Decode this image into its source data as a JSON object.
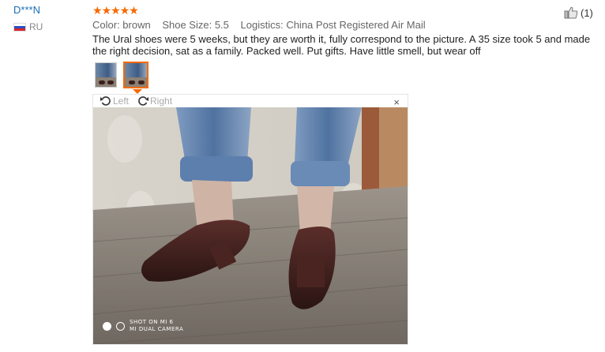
{
  "reviewer": {
    "name": "D***N",
    "country_code": "RU",
    "flag_icon": "russia-flag-icon"
  },
  "rating": {
    "stars": 5,
    "max": 5,
    "color": "#f56a00"
  },
  "attributes": {
    "color": "Color: brown",
    "shoe_size": "Shoe Size: 5.5",
    "logistics": "Logistics: China Post Registered Air Mail"
  },
  "review_text": "The Ural shoes were 5 weeks, but they are worth it, fully correspond to the picture. A 35 size took 5 and made the right decision, sat as a family. Packed well. Put gifts. Have little smell, but wear off",
  "helpful": {
    "icon": "thumbs-up-icon",
    "count": "(1)"
  },
  "thumbnails": [
    {
      "name": "review-photo-1",
      "selected": false
    },
    {
      "name": "review-photo-2",
      "selected": true
    }
  ],
  "viewer": {
    "rotate_left_label": "Left",
    "rotate_right_label": "Right",
    "close_label": "×",
    "watermark_line1": "SHOT ON MI 6",
    "watermark_line2": "MI DUAL CAMERA"
  }
}
